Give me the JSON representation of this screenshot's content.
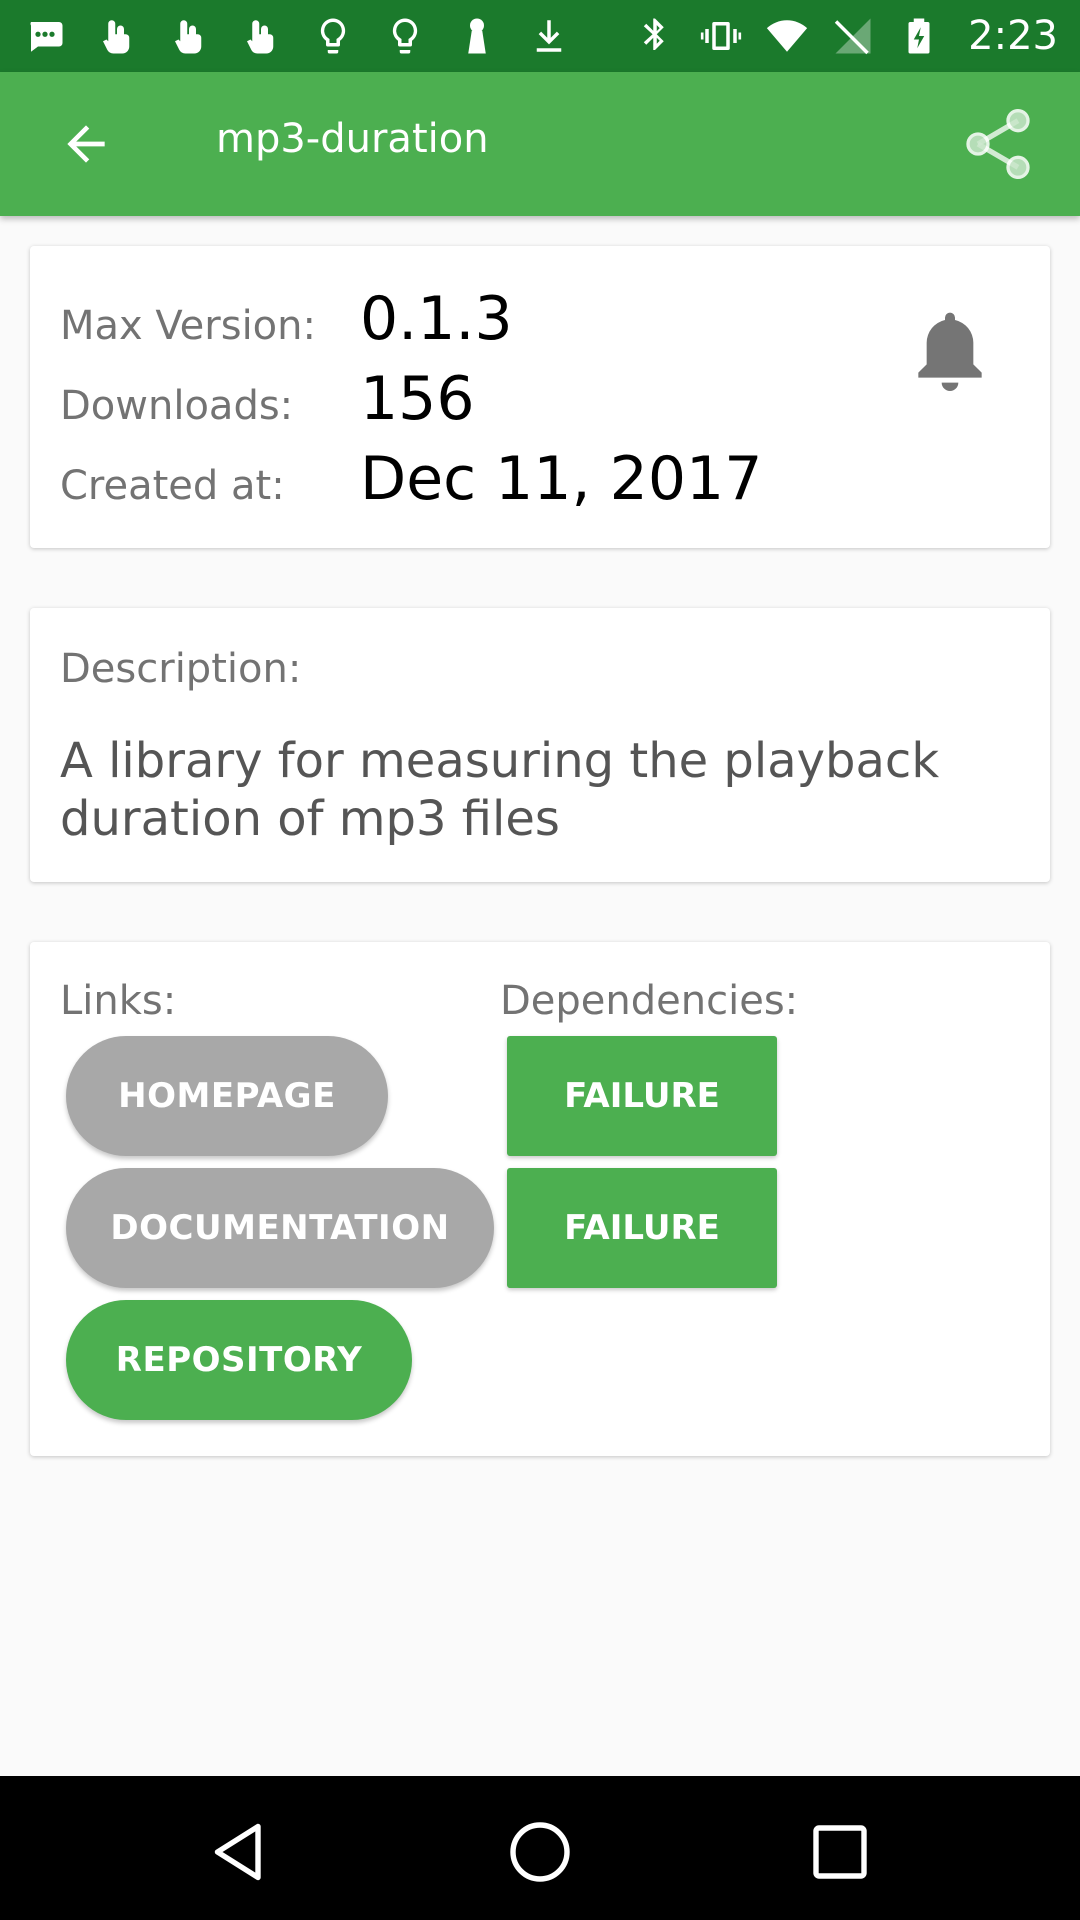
{
  "status_bar": {
    "time": "2:23",
    "left_icons": [
      "message-icon",
      "touch-icon",
      "touch-icon",
      "touch-icon",
      "lightbulb-icon",
      "lightbulb-icon",
      "keyhole-icon",
      "download-icon"
    ],
    "right_icons": [
      "bluetooth-icon",
      "vibrate-icon",
      "wifi-icon",
      "no-signal-icon",
      "battery-charging-icon"
    ]
  },
  "app_bar": {
    "title": "mp3-duration",
    "back_icon": "arrow-back-icon",
    "share_icon": "share-icon"
  },
  "info": {
    "max_version_label": "Max Version:",
    "max_version": "0.1.3",
    "downloads_label": "Downloads:",
    "downloads": "156",
    "created_label": "Created at:",
    "created": "Dec 11, 2017",
    "bell_icon": "bell-icon"
  },
  "description": {
    "label": "Description:",
    "text": "A library for measuring the playback duration of mp3 files"
  },
  "links": {
    "label": "Links:",
    "homepage": "HOMEPAGE",
    "documentation": "DOCUMENTATION",
    "repository": "REPOSITORY"
  },
  "dependencies": {
    "label": "Dependencies:",
    "items": [
      "FAILURE",
      "FAILURE"
    ]
  },
  "colors": {
    "primary": "#4caf50",
    "status_bar": "#1b7a2c",
    "disabled_button": "#a8a8a8"
  }
}
